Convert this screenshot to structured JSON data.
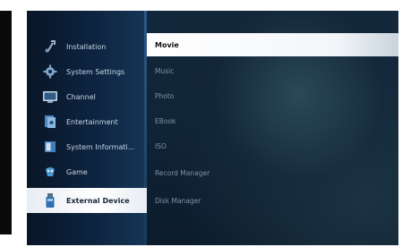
{
  "main_menu": {
    "items": [
      {
        "label": "Installation",
        "icon": "wrench-icon",
        "selected": false
      },
      {
        "label": "System Settings",
        "icon": "gear-icon",
        "selected": false
      },
      {
        "label": "Channel",
        "icon": "tv-icon",
        "selected": false
      },
      {
        "label": "Entertainment",
        "icon": "media-icon",
        "selected": false
      },
      {
        "label": "System Informati...",
        "icon": "info-icon",
        "selected": false
      },
      {
        "label": "Game",
        "icon": "joystick-icon",
        "selected": false
      },
      {
        "label": "External Device",
        "icon": "usb-icon",
        "selected": true
      }
    ]
  },
  "sub_menu": {
    "items": [
      {
        "label": "Movie",
        "selected": true
      },
      {
        "label": "Music",
        "selected": false
      },
      {
        "label": "Photo",
        "selected": false
      },
      {
        "label": "EBook",
        "selected": false
      },
      {
        "label": "ISO",
        "selected": false
      },
      {
        "label": "Record Manager",
        "selected": false
      },
      {
        "label": "Disk Manager",
        "selected": false
      }
    ]
  },
  "colors": {
    "sidebar_bg": "#0d2440",
    "highlight": "#ffffff",
    "menu_text": "#c8d6e6",
    "submenu_text": "#7f93a6"
  }
}
